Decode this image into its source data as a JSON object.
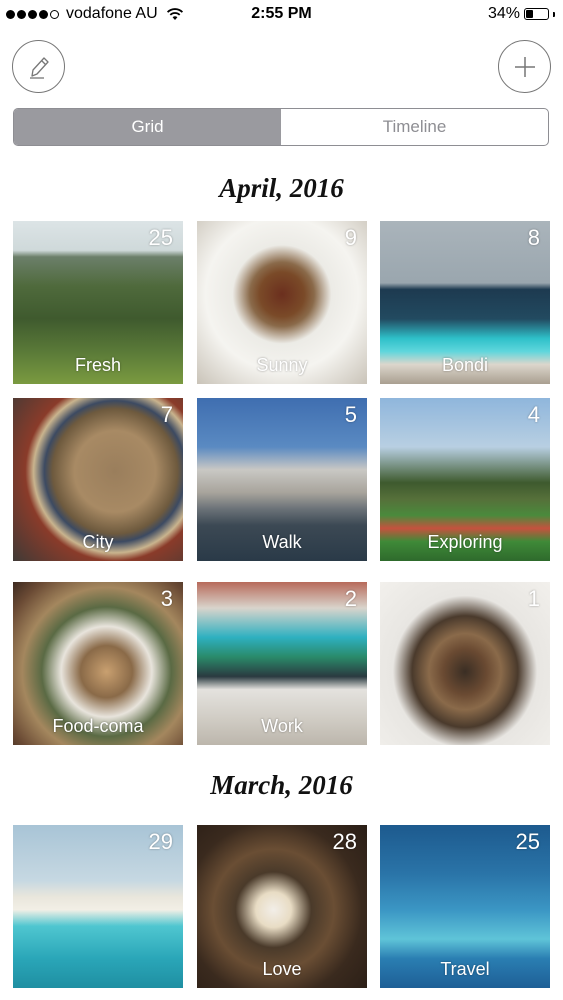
{
  "status_bar": {
    "carrier": "vodafone AU",
    "time": "2:55 PM",
    "battery": "34%",
    "battery_level": 0.34
  },
  "toolbar": {
    "edit_icon": "pencil-icon",
    "add_icon": "plus-icon"
  },
  "segmented_control": {
    "grid_label": "Grid",
    "timeline_label": "Timeline",
    "selected": "Grid"
  },
  "sections": [
    {
      "title": "April, 2016",
      "albums": [
        {
          "count": "25",
          "label": "Fresh"
        },
        {
          "count": "9",
          "label": "Sunny"
        },
        {
          "count": "8",
          "label": "Bondi"
        },
        {
          "count": "7",
          "label": "City"
        },
        {
          "count": "5",
          "label": "Walk"
        },
        {
          "count": "4",
          "label": "Exploring"
        },
        {
          "count": "3",
          "label": "Food-coma"
        },
        {
          "count": "2",
          "label": "Work"
        },
        {
          "count": "1",
          "label": ""
        }
      ]
    },
    {
      "title": "March, 2016",
      "albums": [
        {
          "count": "29",
          "label": ""
        },
        {
          "count": "28",
          "label": "Love"
        },
        {
          "count": "25",
          "label": "Travel"
        }
      ]
    }
  ],
  "colors": {
    "segment_active": "#9a9a9f",
    "segment_border": "#8e8e93",
    "button_border": "#777777"
  }
}
